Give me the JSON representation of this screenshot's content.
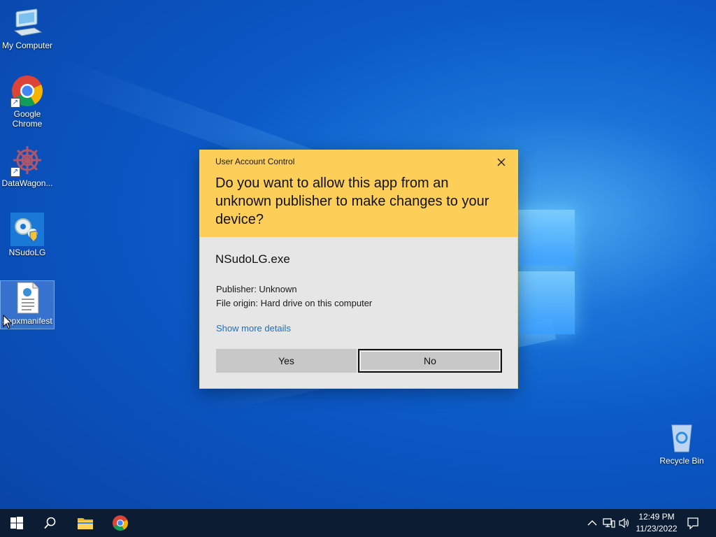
{
  "desktop": {
    "icons": [
      {
        "label": "My Computer"
      },
      {
        "label": "Google Chrome"
      },
      {
        "label": "DataWagon..."
      },
      {
        "label": "NSudoLG"
      },
      {
        "label": "appxmanifest"
      },
      {
        "label": "Recycle Bin"
      }
    ]
  },
  "uac": {
    "title": "User Account Control",
    "close_icon": "close-icon",
    "question": "Do you want to allow this app from an unknown publisher to make changes to your device?",
    "app_name": "NSudoLG.exe",
    "publisher": "Publisher: Unknown",
    "file_origin": "File origin: Hard drive on this computer",
    "show_more": "Show more details",
    "yes_label": "Yes",
    "no_label": "No",
    "header_color": "#fdcf58"
  },
  "taskbar": {
    "items": [
      "start-icon",
      "search-icon",
      "file-explorer-icon",
      "chrome-icon"
    ],
    "tray": [
      "chevron-up-icon",
      "network-icon",
      "volume-icon",
      "notification-icon"
    ],
    "time": "12:49 PM",
    "date": "11/23/2022",
    "color": "#0b1c33"
  }
}
